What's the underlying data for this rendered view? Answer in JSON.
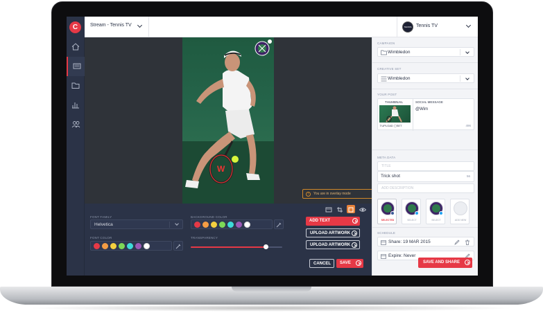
{
  "topbar": {
    "logo_letter": "C",
    "stream": "Stream - Tennis TV",
    "account_avatar_text": "TENNIS TV",
    "account_name": "Tennis TV"
  },
  "nav": [
    "home-icon",
    "media-icon",
    "folder-icon",
    "analytics-icon",
    "users-icon"
  ],
  "canvas": {
    "overlay_notice": "You are in overlay mode"
  },
  "editor": {
    "font_family_label": "FONT FAMILY",
    "font_family_value": "Helvetica",
    "font_color_label": "FONT COLOR",
    "background_color_label": "BACKGROUND COLOR",
    "transparency_label": "TRANSPARENCY",
    "transparency_value": 0.82,
    "font_colors": [
      "#e63946",
      "#f39c44",
      "#f4d03f",
      "#7ed957",
      "#3ddbd9",
      "#9b59b6",
      "#ffffff"
    ],
    "background_colors": [
      "#e63946",
      "#f39c44",
      "#f4d03f",
      "#7ed957",
      "#3ddbd9",
      "#9b59b6",
      "#ffffff"
    ],
    "add_text": "ADD TEXT",
    "upload_artwork_1": "UPLOAD ARTWORK",
    "upload_artwork_2": "UPLOAD ARTWORK",
    "cancel": "CANCEL",
    "save": "SAVE"
  },
  "panel": {
    "campaign_label": "CAMPAIGN",
    "campaign_value": "Wimbledon",
    "creative_set_label": "CREATIVE SET",
    "creative_set_value": "Wimbledon",
    "your_post_label": "YOUR POST",
    "thumbnail_label": "THUMBNAIL",
    "thumb_upload": "UPLOAD",
    "thumb_set": "SET",
    "social_message_label": "SOCIAL MESSAGE",
    "social_message_value": "@Wim",
    "social_message_count": "496",
    "meta_data_label": "META DATA",
    "title_placeholder": "TITLE",
    "meta_title_value": "Trick shot",
    "meta_count": "56",
    "description_placeholder": "ADD DESCRIPTION",
    "creatives": [
      {
        "caption": "SELECTED",
        "selected": true,
        "network": "facebook"
      },
      {
        "caption": "SELECT",
        "selected": false,
        "network": "twitter"
      },
      {
        "caption": "SELECT",
        "selected": false,
        "network": "twitter"
      },
      {
        "caption": "ADD NEW",
        "selected": false,
        "network": "none"
      }
    ],
    "schedule_label": "SCHEDULE",
    "share_date": "Share: 19 MAR 2015",
    "expire": "Expire: Never",
    "save_and_share": "SAVE AND SHARE"
  },
  "colors": {
    "accent": "#e63946",
    "navy": "#2b3347",
    "overlay_warning": "#d1892a",
    "active_mode": "#e8833a"
  }
}
